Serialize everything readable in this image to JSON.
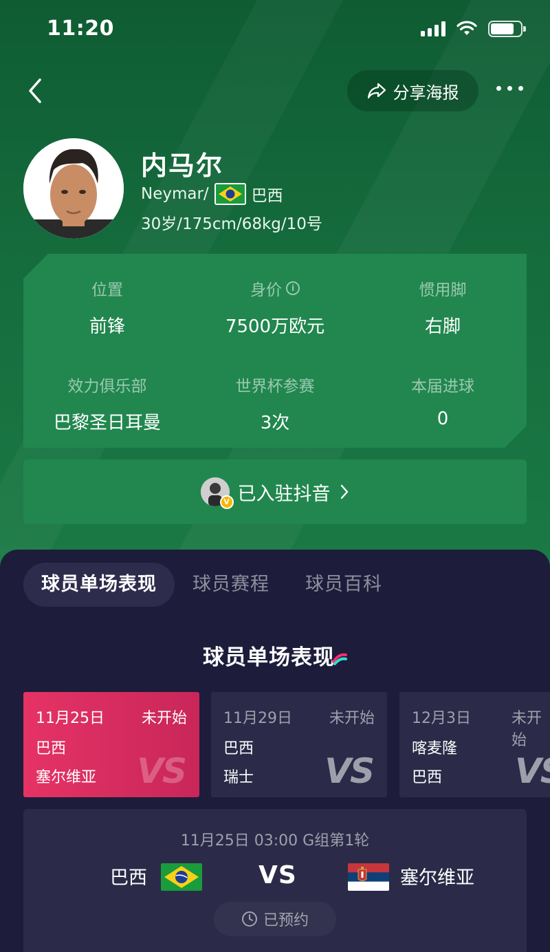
{
  "status_bar": {
    "time": "11:20"
  },
  "nav": {
    "share_label": "分享海报"
  },
  "player": {
    "name": "内马尔",
    "en_name": "Neymar/",
    "country": "巴西",
    "details": "30岁/175cm/68kg/10号"
  },
  "info": [
    {
      "label": "位置",
      "value": "前锋"
    },
    {
      "label": "身价",
      "value": "7500万欧元",
      "has_info_icon": true
    },
    {
      "label": "惯用脚",
      "value": "右脚"
    },
    {
      "label": "效力俱乐部",
      "value": "巴黎圣日耳曼"
    },
    {
      "label": "世界杯参赛",
      "value": "3次"
    },
    {
      "label": "本届进球",
      "value": "0"
    }
  ],
  "douyin": {
    "label": "已入驻抖音"
  },
  "tabs": [
    {
      "label": "球员单场表现",
      "active": true
    },
    {
      "label": "球员赛程",
      "active": false
    },
    {
      "label": "球员百科",
      "active": false
    }
  ],
  "section_title": "球员单场表现",
  "matches": [
    {
      "date": "11月25日",
      "status": "未开始",
      "team1": "巴西",
      "team2": "塞尔维亚",
      "vs": "VS",
      "active": true
    },
    {
      "date": "11月29日",
      "status": "未开始",
      "team1": "巴西",
      "team2": "瑞士",
      "vs": "VS",
      "active": false
    },
    {
      "date": "12月3日",
      "status": "未开始",
      "team1": "喀麦隆",
      "team2": "巴西",
      "vs": "VS",
      "active": false
    }
  ],
  "detail": {
    "meta": "11月25日 03:00 G组第1轮",
    "home": "巴西",
    "vs": "VS",
    "away": "塞尔维亚",
    "button": "已预约"
  },
  "colors": {
    "green_bg": "#156c3d",
    "card_green": "#21874e",
    "dark_bg": "#1d1c3a",
    "card_dark": "#2b2a48",
    "accent_pink": "#e53364"
  }
}
